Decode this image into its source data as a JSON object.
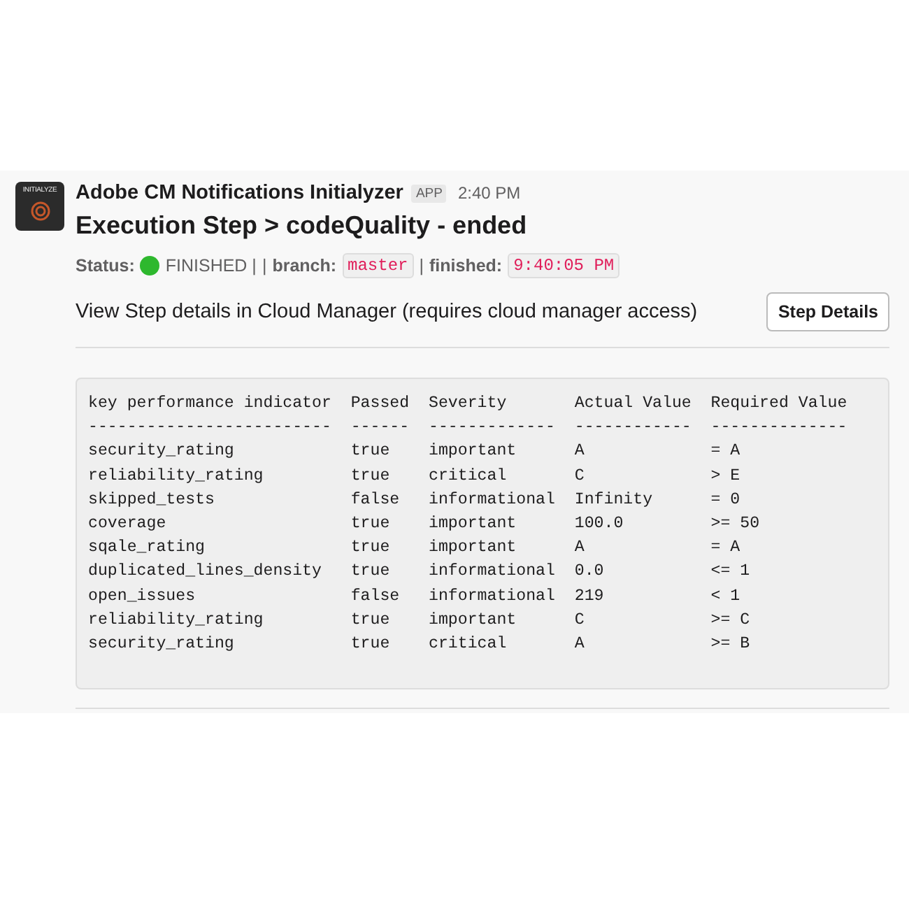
{
  "message": {
    "avatar_label": "INITIALYZE",
    "sender": "Adobe CM Notifications Initialyzer",
    "badge": "APP",
    "time": "2:40 PM",
    "title": "Execution Step > codeQuality - ended",
    "status_parts": [
      {
        "kind": "label",
        "text": "Status:"
      },
      {
        "kind": "dot",
        "color": "#2eb82e"
      },
      {
        "kind": "text",
        "text": "FINISHED |"
      },
      {
        "kind": "text",
        "text": "|"
      },
      {
        "kind": "label",
        "text": "branch:"
      },
      {
        "kind": "code",
        "text": "master"
      },
      {
        "kind": "text",
        "text": "|"
      },
      {
        "kind": "label",
        "text": "finished:"
      },
      {
        "kind": "code",
        "text": "9:40:05 PM"
      }
    ],
    "details_text": "View Step details in Cloud Manager (requires cloud manager access)",
    "details_button": "Step Details",
    "code_lines": [
      "key performance indicator  Passed  Severity       Actual Value  Required Value",
      "-------------------------  ------  -------------  ------------  --------------",
      "security_rating            true    important      A             = A",
      "reliability_rating         true    critical       C             > E",
      "skipped_tests              false   informational  Infinity      = 0",
      "coverage                   true    important      100.0         >= 50",
      "sqale_rating               true    important      A             = A",
      "duplicated_lines_density   true    informational  0.0           <= 1",
      "open_issues                false   informational  219           < 1",
      "reliability_rating         true    important      C             >= C",
      "security_rating            true    critical       A             >= B"
    ]
  }
}
